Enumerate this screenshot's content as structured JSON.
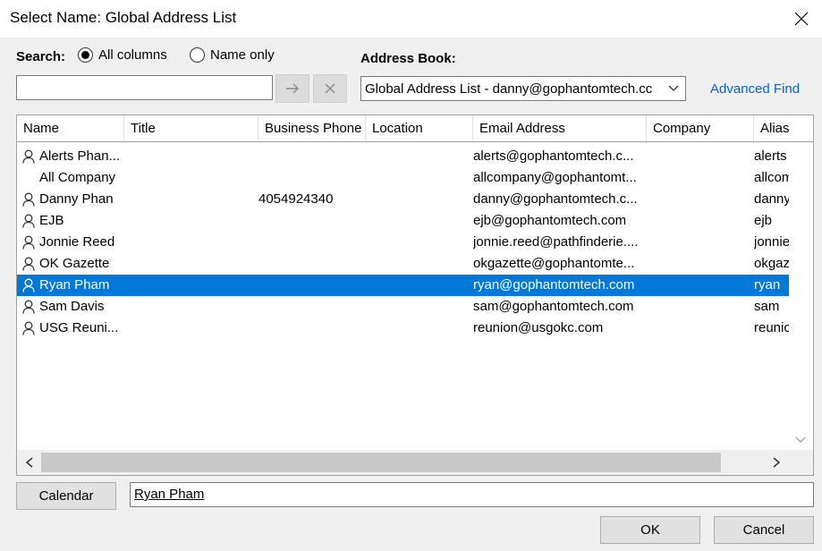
{
  "window": {
    "title": "Select Name: Global Address List",
    "close_icon": "close-icon"
  },
  "search": {
    "label": "Search:",
    "radio_all": "All columns",
    "radio_name": "Name only",
    "selected_mode": "All columns",
    "input_value": "",
    "go_icon": "arrow-right-icon",
    "clear_icon": "clear-x-icon"
  },
  "address_book": {
    "label": "Address Book:",
    "selected": "Global Address List - danny@gophantomtech.cc",
    "advanced_find": "Advanced Find"
  },
  "table": {
    "columns": [
      "Name",
      "Title",
      "Business Phone",
      "Location",
      "Email Address",
      "Company",
      "Alias"
    ],
    "rows": [
      {
        "icon": "user-icon",
        "name": "Alerts Phan...",
        "phone": "",
        "email": "alerts@gophantomtech.c...",
        "alias": "alerts"
      },
      {
        "icon": "",
        "name": "All Company",
        "phone": "",
        "email": "allcompany@gophantomt...",
        "alias": "allcom"
      },
      {
        "icon": "user-icon",
        "name": "Danny Phan",
        "phone": "4054924340",
        "email": "danny@gophantomtech.c...",
        "alias": "danny"
      },
      {
        "icon": "user-icon",
        "name": "EJB",
        "phone": "",
        "email": "ejb@gophantomtech.com",
        "alias": "ejb"
      },
      {
        "icon": "user-icon",
        "name": "Jonnie Reed",
        "phone": "",
        "email": "jonnie.reed@pathfinderie....",
        "alias": "jonnie"
      },
      {
        "icon": "user-icon",
        "name": "OK Gazette",
        "phone": "",
        "email": "okgazette@gophantomte...",
        "alias": "okgaz"
      },
      {
        "icon": "user-icon",
        "name": "Ryan Pham",
        "phone": "",
        "email": "ryan@gophantomtech.com",
        "alias": "ryan"
      },
      {
        "icon": "user-icon",
        "name": "Sam Davis",
        "phone": "",
        "email": "sam@gophantomtech.com",
        "alias": "sam"
      },
      {
        "icon": "user-icon",
        "name": "USG Reuni...",
        "phone": "",
        "email": "reunion@usgokc.com",
        "alias": "reunic"
      }
    ],
    "selected_name": "Ryan Pham"
  },
  "footer": {
    "calendar_label": "Calendar",
    "selected_value": "Ryan Pham",
    "ok_label": "OK",
    "cancel_label": "Cancel"
  }
}
